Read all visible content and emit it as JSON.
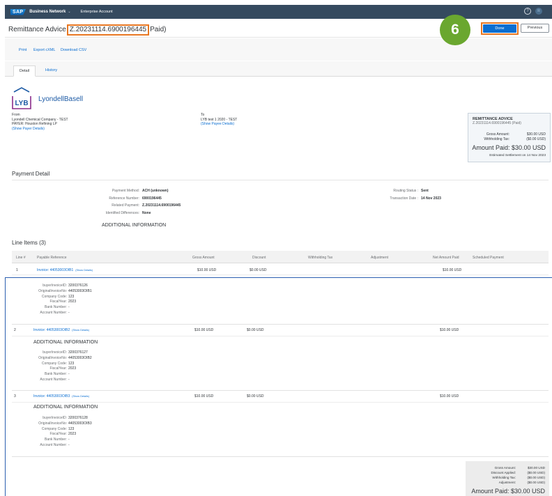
{
  "shell": {
    "logo": "SAP",
    "product": "Business Network",
    "product_chevron": "⌄",
    "account": "Enterprise Account",
    "help_icon": "?",
    "user_icon": "R"
  },
  "header": {
    "title_prefix": "Remittance Advice",
    "title_highlight": "Z.20231114.6900196445",
    "title_suffix": "Paid)",
    "step_number": "6",
    "done_label": "Done",
    "previous_label": "Previous",
    "highlight_color": "#e87722",
    "badge_color": "#6aa72f"
  },
  "actions": {
    "print": "Print",
    "export": "Export cXML",
    "download": "Download CSV"
  },
  "tabs": [
    {
      "label": "Detail",
      "active": true
    },
    {
      "label": "History",
      "active": false
    }
  ],
  "company": {
    "logo_letters": "LYB",
    "logo_name": "LyondellBasell"
  },
  "from": {
    "label": "From",
    "name": "Lyondell Chemical Company - TEST",
    "payer": "PAYER:  Houston Refining LP",
    "link": "(Show Payer Details)"
  },
  "to": {
    "label": "To",
    "name": "LYB test 1 2020 - TEST",
    "link": "(Show Payee Details)"
  },
  "summary": {
    "title": "REMITTANCE ADVICE",
    "ref": "Z.20231114.6900196445",
    "status": "(Paid)",
    "gross_label": "Gross Amount:",
    "gross_value": "$30.00 USD",
    "withholding_label": "Withholding Tax:",
    "withholding_value": "($0.00 USD)",
    "paid_label": "Amount Paid:",
    "paid_value": "$30.00 USD",
    "settlement": "Estimated Settlement on 14 Nov 2023"
  },
  "payment_detail": {
    "title": "Payment Detail",
    "method_label": "Payment Method:",
    "method_value": "ACH (unknown)",
    "reference_label": "Reference Number:",
    "reference_value": "6900196445",
    "related_label": "Related Payment:",
    "related_value": "Z.20231114.6900196445",
    "differences_label": "Identified Differences:",
    "differences_value": "None",
    "routing_label": "Routing Status :",
    "routing_value": "Sent",
    "transaction_label": "Transaction Date :",
    "transaction_value": "14 Nov 2023",
    "additional": "ADDITIONAL INFORMATION"
  },
  "line_items": {
    "title": "Line Items (3)",
    "columns": [
      "Line #",
      "Payable Reference",
      "Gross Amount",
      "Discount",
      "Withholding Tax",
      "Adjustment",
      "Net Amount Paid",
      "Scheduled Payment"
    ],
    "rows": [
      {
        "line": "1",
        "reference": "Invoice: 44053003OIB1",
        "show": "(Show Details)",
        "gross": "$10.00 USD",
        "discount": "$0.00 USD",
        "net": "$10.00 USD",
        "additional": "",
        "buyer_label": "buyerInvoiceID:",
        "buyer": "3200376126",
        "orig_label": "OriginalInvoiceNo:",
        "orig": "44053003OIB1",
        "company_label": "Company Code:",
        "company": "123",
        "fiscal_label": "FiscalYear:",
        "fiscal": "2023",
        "bank_label": "Bank Number:",
        "bank": "-",
        "account_label": "Account Number:",
        "account": "-"
      },
      {
        "line": "2",
        "reference": "Invoice: 44053003OIB2",
        "show": "(Show Details)",
        "gross": "$10.00 USD",
        "discount": "$0.00 USD",
        "net": "$10.00 USD",
        "additional": "ADDITIONAL INFORMATION",
        "buyer_label": "buyerInvoiceID:",
        "buyer": "3200376127",
        "orig_label": "OriginalInvoiceNo:",
        "orig": "44053003OIB2",
        "company_label": "Company Code:",
        "company": "123",
        "fiscal_label": "FiscalYear:",
        "fiscal": "2023",
        "bank_label": "Bank Number:",
        "bank": "-",
        "account_label": "Account Number:",
        "account": "-"
      },
      {
        "line": "3",
        "reference": "Invoice: 44053003OIB3",
        "show": "(Show Details)",
        "gross": "$10.00 USD",
        "discount": "$0.00 USD",
        "net": "$10.00 USD",
        "additional": "ADDITIONAL INFORMATION",
        "buyer_label": "buyerInvoiceID:",
        "buyer": "3200376128",
        "orig_label": "OriginalInvoiceNo:",
        "orig": "44053003OIB3",
        "company_label": "Company Code:",
        "company": "123",
        "fiscal_label": "FiscalYear:",
        "fiscal": "2023",
        "bank_label": "Bank Number:",
        "bank": "-",
        "account_label": "Account Number:",
        "account": "-"
      }
    ]
  },
  "totals": {
    "gross_label": "Gross Amount:",
    "gross": "$30.00 USD",
    "discount_label": "Discount Applied:",
    "discount": "($0.00 USD)",
    "withholding_label": "Withholding Tax:",
    "withholding": "($0.00 USD)",
    "adjustment_label": "Adjustment:",
    "adjustment": "($0.00 USD)",
    "paid_label": "Amount Paid:",
    "paid": "$30.00 USD"
  }
}
